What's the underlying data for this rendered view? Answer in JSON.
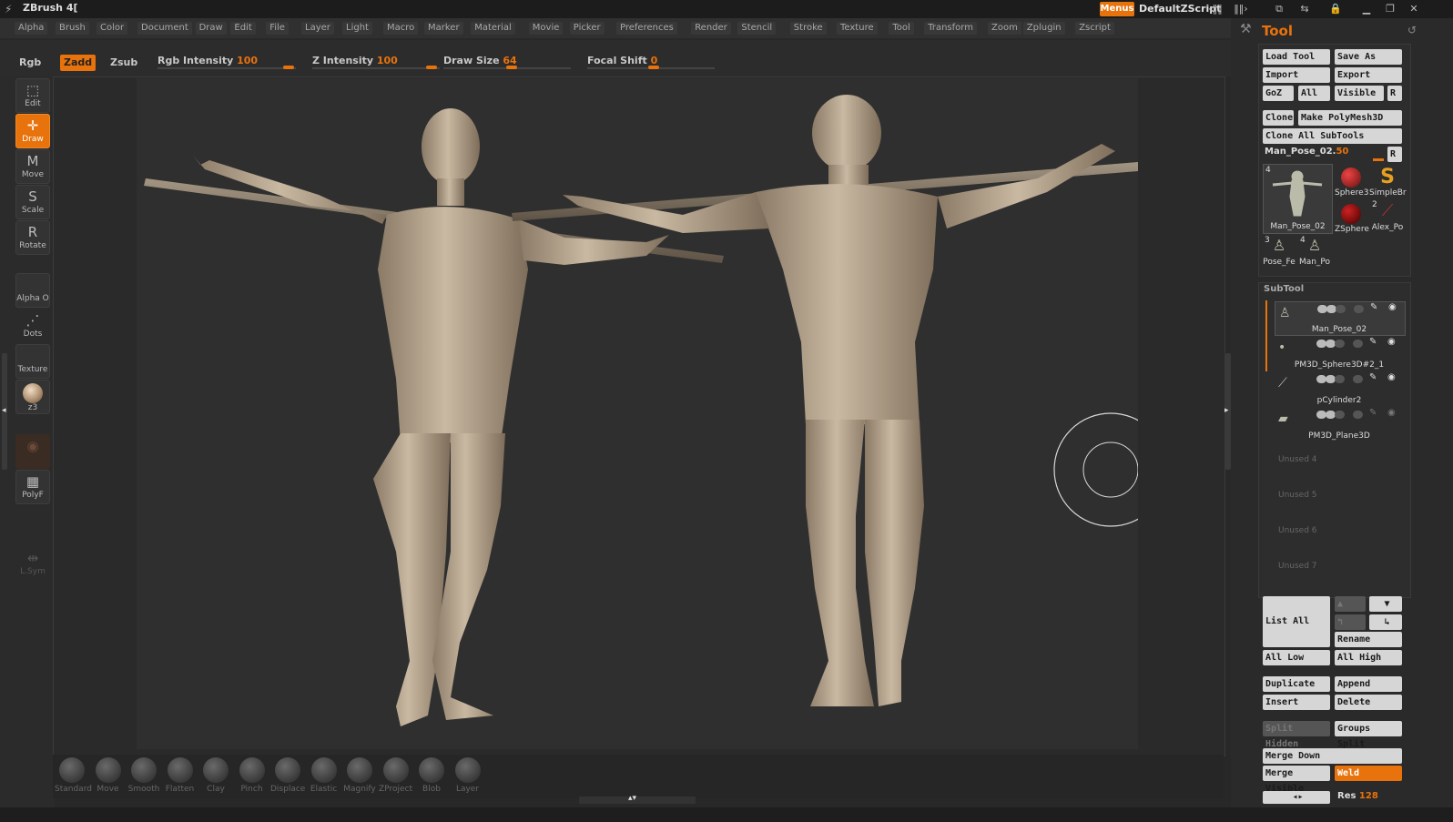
{
  "app": {
    "title": "ZBrush 4["
  },
  "titlebar": {
    "menus_label": "Menus",
    "zscript_label": "DefaultZScript"
  },
  "menubar": {
    "items": [
      "Alpha",
      "Brush",
      "Color",
      "Document",
      "Draw",
      "Edit",
      "File",
      "Layer",
      "Light",
      "Macro",
      "Marker",
      "Material",
      "Movie",
      "Picker",
      "Preferences",
      "Render",
      "Stencil",
      "Stroke",
      "Texture",
      "Tool",
      "Transform",
      "Zoom",
      "Zplugin",
      "Zscript"
    ]
  },
  "toolbar": {
    "rgb_label": "Rgb",
    "zadd_label": "Zadd",
    "zsub_label": "Zsub",
    "rgb_intensity": {
      "label": "Rgb Intensity",
      "value": "100"
    },
    "z_intensity": {
      "label": "Z Intensity",
      "value": "100"
    },
    "draw_size": {
      "label": "Draw Size",
      "value": "64"
    },
    "focal_shift": {
      "label": "Focal Shift",
      "value": "0"
    }
  },
  "leftshelf": {
    "edit": "Edit",
    "draw": "Draw",
    "move": "Move",
    "scale": "Scale",
    "rotate": "Rotate",
    "alpha": "Alpha O",
    "dots": "Dots",
    "texture": "Texture",
    "material": "z3",
    "polyf": "PolyF",
    "lsym": "L.Sym"
  },
  "brushes": [
    "Standard",
    "Move",
    "Smooth",
    "Flatten",
    "Clay",
    "Pinch",
    "Displace",
    "Elastic",
    "Magnify",
    "ZProject",
    "Blob",
    "Layer"
  ],
  "tool": {
    "heading": "Tool",
    "load_tool": "Load Tool",
    "save_as": "Save As",
    "import": "Import",
    "export": "Export",
    "goz": "GoZ",
    "all": "All",
    "visible": "Visible",
    "r": "R",
    "clone": "Clone",
    "make_polymesh": "Make PolyMesh3D",
    "clone_all": "Clone All SubTools",
    "current_tool": "Man_Pose_02.",
    "current_value": "50",
    "thumbs": [
      {
        "label": "Man_Pose_02",
        "count": "4"
      },
      {
        "label": "Sphere3"
      },
      {
        "label": "SimpleBr"
      },
      {
        "label": "ZSphere"
      },
      {
        "label": "Alex_Po",
        "count": "2"
      },
      {
        "label": "Pose_Fe",
        "count": "3"
      },
      {
        "label": "Man_Po",
        "count": "4"
      }
    ]
  },
  "subtool": {
    "heading": "SubTool",
    "items": [
      "Man_Pose_02",
      "PM3D_Sphere3D#2_1",
      "pCylinder2",
      "PM3D_Plane3D"
    ],
    "unused": [
      "Unused 4",
      "Unused 5",
      "Unused 6",
      "Unused 7"
    ],
    "list_all": "List All",
    "rename": "Rename",
    "all_low": "All Low",
    "all_high": "All High",
    "duplicate": "Duplicate",
    "append": "Append",
    "insert": "Insert",
    "delete": "Delete",
    "split_hidden": "Split Hidden",
    "groups_split": "Groups Split",
    "merge_down": "Merge Down",
    "merge_visible": "Merge Visible",
    "weld": "Weld",
    "res_label": "Res",
    "res_value": "128"
  }
}
